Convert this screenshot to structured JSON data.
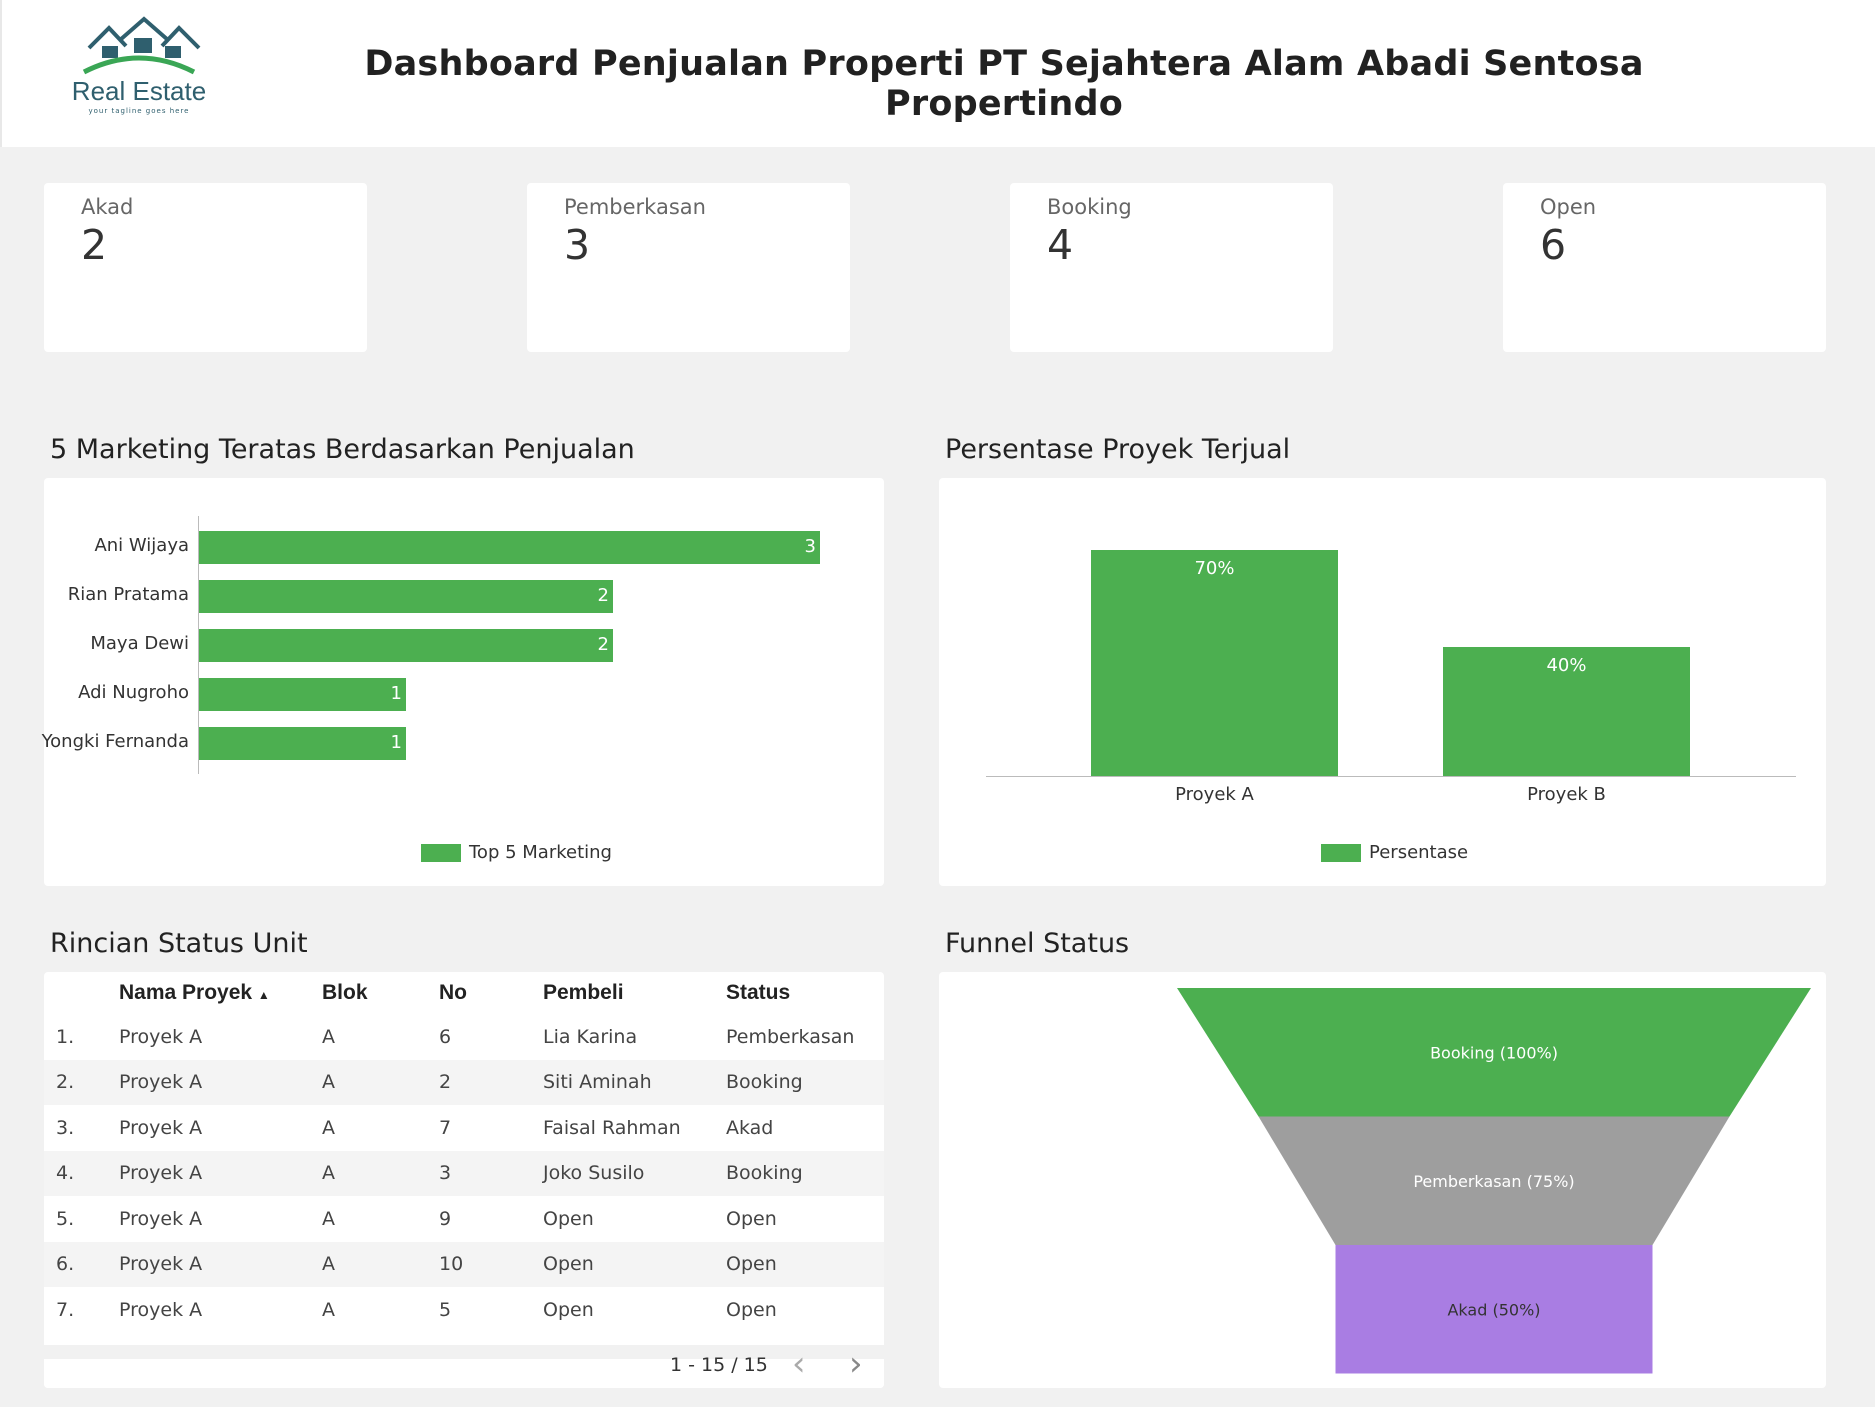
{
  "header": {
    "logo_text": "Real Estate",
    "logo_tagline": "your tagline goes here",
    "title": "Dashboard Penjualan Properti PT Sejahtera Alam Abadi Sentosa Propertindo"
  },
  "kpis": [
    {
      "label": "Akad",
      "value": "2"
    },
    {
      "label": "Pemberkasan",
      "value": "3"
    },
    {
      "label": "Booking",
      "value": "4"
    },
    {
      "label": "Open",
      "value": "6"
    }
  ],
  "colors": {
    "green": "#4caf50",
    "grey": "#9e9e9e",
    "purple": "#a97de3"
  },
  "chart_data": [
    {
      "type": "bar",
      "orientation": "horizontal",
      "title": "5 Marketing Teratas Berdasarkan Penjualan",
      "categories": [
        "Ani Wijaya",
        "Rian Pratama",
        "Maya Dewi",
        "Adi Nugroho",
        "Yongki Fernanda"
      ],
      "series": [
        {
          "name": "Top 5 Marketing",
          "values": [
            3,
            2,
            2,
            1,
            1
          ]
        }
      ],
      "legend": "bottom",
      "grid": false
    },
    {
      "type": "bar",
      "title": "Persentase Proyek Terjual",
      "categories": [
        "Proyek A",
        "Proyek B"
      ],
      "series": [
        {
          "name": "Persentase",
          "values": [
            70,
            40
          ]
        }
      ],
      "value_labels": [
        "70%",
        "40%"
      ],
      "legend": "bottom",
      "grid": false
    },
    {
      "type": "funnel",
      "title": "Funnel Status",
      "stages": [
        {
          "label": "Booking (100%)",
          "value": 100
        },
        {
          "label": "Pemberkasan (75%)",
          "value": 75
        },
        {
          "label": "Akad (50%)",
          "value": 50
        }
      ]
    }
  ],
  "table": {
    "title": "Rincian Status Unit",
    "columns": [
      "Nama Proyek",
      "Blok",
      "No",
      "Pembeli",
      "Status"
    ],
    "sort_indicator": "▲",
    "rows": [
      [
        "1.",
        "Proyek A",
        "A",
        "6",
        "Lia Karina",
        "Pemberkasan"
      ],
      [
        "2.",
        "Proyek A",
        "A",
        "2",
        "Siti Aminah",
        "Booking"
      ],
      [
        "3.",
        "Proyek A",
        "A",
        "7",
        "Faisal Rahman",
        "Akad"
      ],
      [
        "4.",
        "Proyek A",
        "A",
        "3",
        "Joko Susilo",
        "Booking"
      ],
      [
        "5.",
        "Proyek A",
        "A",
        "9",
        "Open",
        "Open"
      ],
      [
        "6.",
        "Proyek A",
        "A",
        "10",
        "Open",
        "Open"
      ],
      [
        "7.",
        "Proyek A",
        "A",
        "5",
        "Open",
        "Open"
      ]
    ],
    "pagination": "1 - 15 / 15",
    "prev": "‹",
    "next": "›"
  }
}
